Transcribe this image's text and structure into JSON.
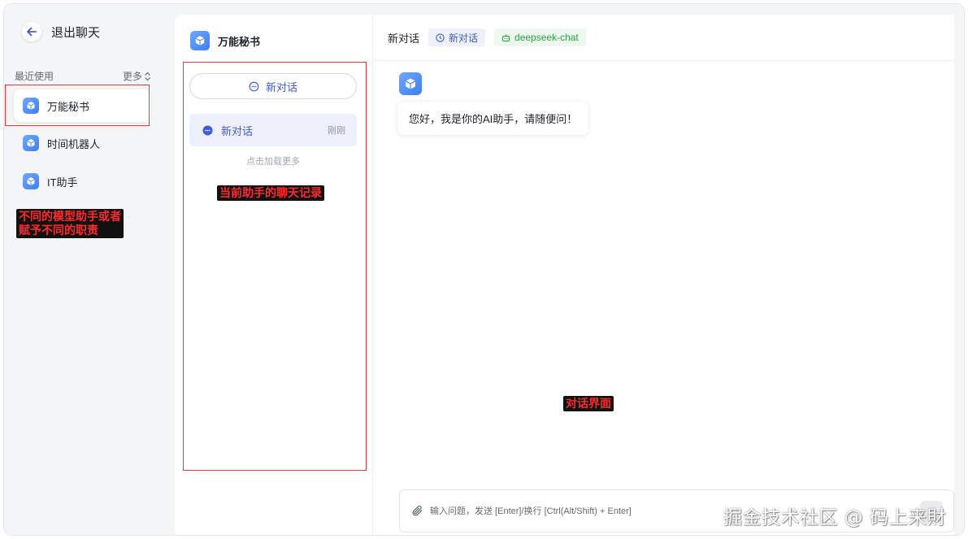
{
  "sidebar": {
    "back_label": "退出聊天",
    "recent_label": "最近使用",
    "more_label": "更多",
    "items": [
      {
        "label": "万能秘书",
        "icon": "cube-icon"
      },
      {
        "label": "时间机器人",
        "icon": "cube-icon"
      },
      {
        "label": "IT助手",
        "icon": "cube-icon"
      }
    ]
  },
  "history": {
    "assistant_name": "万能秘书",
    "new_chat_label": "新对话",
    "chats": [
      {
        "title": "新对话",
        "time": "刚刚"
      }
    ],
    "load_more": "点击加载更多"
  },
  "chat": {
    "title": "新对话",
    "tag_new": "新对话",
    "tag_model": "deepseek-chat",
    "greeting": "您好，我是你的AI助手，请随便问！",
    "input_placeholder": "输入问题，发送 [Enter]/换行 [Ctrl(Alt/Shift) + Enter]"
  },
  "annotations": {
    "sidebar_note_line1": "不同的模型助手或者",
    "sidebar_note_line2": "赋予不同的职责",
    "history_note": "当前助手的聊天记录",
    "chat_note": "对话界面"
  },
  "watermark": "掘金技术社区 @ 码上来財",
  "colors": {
    "accent": "#3d5bdb",
    "annotation_border": "#e8373b",
    "annotation_text": "#ff2a2a",
    "model_tag": "#2f9e44"
  }
}
